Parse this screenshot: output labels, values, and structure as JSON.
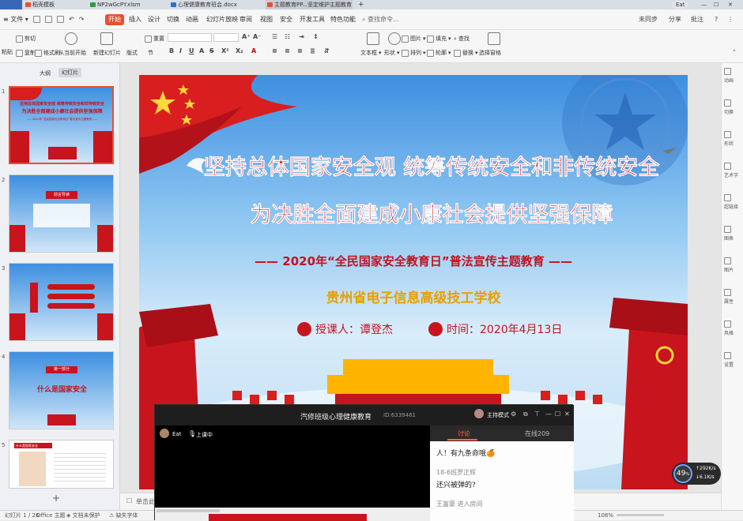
{
  "titlebar": {
    "tabs": [
      {
        "label": "稻壳模板",
        "color": "#e8502f"
      },
      {
        "label": "NP2wGcPY.xlsm",
        "color": "#2e9a4a"
      },
      {
        "label": "心理健康教育班会.docx",
        "color": "#2e6fd1"
      },
      {
        "label": "主题教育PP...坚定维护主题教育",
        "color": "#e8502f"
      }
    ],
    "new_tab": "+",
    "user": "Eat",
    "window_controls": [
      "—",
      "☐",
      "✕"
    ]
  },
  "menubar": {
    "file": "文件",
    "items": [
      "开始",
      "插入",
      "设计",
      "切换",
      "动画",
      "幻灯片放映",
      "审阅",
      "视图",
      "安全",
      "开发工具",
      "特色功能"
    ],
    "active": "开始",
    "search": "查找命令...",
    "right": [
      "未同步",
      "分享",
      "批注"
    ]
  },
  "ribbon": {
    "groups": [
      {
        "label": "粘贴"
      },
      {
        "label": "剪切"
      },
      {
        "label": "复制"
      },
      {
        "label": "格式刷"
      },
      {
        "label": "从当前开始"
      },
      {
        "label": "新建幻灯片"
      },
      {
        "label": "版式"
      },
      {
        "label": "节"
      },
      {
        "label": "重置"
      },
      {
        "label": "图片"
      },
      {
        "label": "填充"
      },
      {
        "label": "查找"
      },
      {
        "label": "文本框"
      },
      {
        "label": "形状"
      },
      {
        "label": "排列"
      },
      {
        "label": "轮廓"
      },
      {
        "label": "替换"
      },
      {
        "label": "选择窗格"
      }
    ]
  },
  "leftpanel": {
    "tabs": [
      "大纲",
      "幻灯片"
    ],
    "active_tab": "幻灯片",
    "slides": [
      {
        "num": "1",
        "l1": "坚持总体国家安全观  统筹传统安全和非传统安全",
        "l2": "为决胜全面建成小康社会提供坚强保障",
        "l3": "——2020年“全民国家安全教育日”普法宣传主题教育——"
      },
      {
        "num": "2",
        "badge": "前言导读"
      },
      {
        "num": "3",
        "badge": ""
      },
      {
        "num": "4",
        "part": "第一部分",
        "heading": "什么是国家安全"
      },
      {
        "num": "5",
        "badge": "什么是国家安全"
      }
    ],
    "add": "+"
  },
  "slide": {
    "title1": "坚持总体国家安全观  统筹传统安全和非传统安全",
    "title2": "为决胜全面建成小康社会提供坚强保障",
    "subtitle": "—— 2020年“全民国家安全教育日”普法宣传主题教育 ——",
    "school": "贵州省电子信息高级技工学校",
    "lecturer": "授课人：谭登杰",
    "date": "时间：2020年4月13日"
  },
  "notes": {
    "placeholder": "单击此处添加备注"
  },
  "meeting": {
    "title": "汽修班级心理健康教育",
    "id": "ID:6339461",
    "mode": "主持模式",
    "host": {
      "name": "Eat",
      "status": "上课中"
    },
    "tabs": [
      {
        "label": "讨论",
        "active": true
      },
      {
        "label": "在线209",
        "active": false
      }
    ],
    "messages": [
      {
        "text": "人！有九条命哦",
        "emoji": "🍊"
      },
      {
        "sender": "18-6班罗正辉",
        "text": "还兴被弹的?"
      },
      {
        "system": "王富豪 进入房间"
      }
    ]
  },
  "righttb": [
    "动画",
    "切换",
    "形状",
    "艺术字",
    "超链接",
    "图表",
    "图片",
    "属性",
    "风格",
    "设置"
  ],
  "status": {
    "slide": "幻灯片 1 / 26",
    "theme": "Office 主题",
    "backup": "文档未保护",
    "font": "缺失字体",
    "zoom": "108%"
  },
  "netwidget": {
    "percent": "49",
    "unit": "%",
    "up": "292",
    "up_unit": "K/s",
    "down": "6.1",
    "down_unit": "K/s"
  }
}
